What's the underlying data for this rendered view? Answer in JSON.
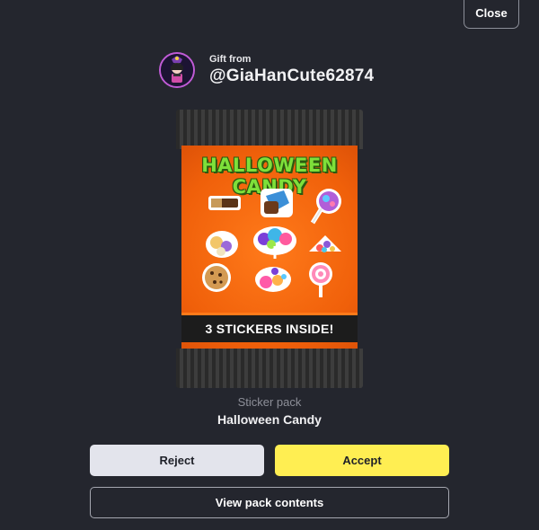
{
  "header": {
    "close_label": "Close"
  },
  "gift": {
    "from_label": "Gift from",
    "username": "@GiaHanCute62874"
  },
  "pack": {
    "artwork_title": "HALLOWEEN CANDY",
    "artwork_banner": "3 STICKERS INSIDE!",
    "type_label": "Sticker pack",
    "name": "Halloween Candy"
  },
  "actions": {
    "reject_label": "Reject",
    "accept_label": "Accept",
    "view_contents_label": "View pack contents"
  },
  "colors": {
    "background": "#24262e",
    "accept": "#ffee52",
    "reject": "#e3e4ec",
    "pack_orange": "#f0600a",
    "pack_title_green": "#7ee03a"
  }
}
